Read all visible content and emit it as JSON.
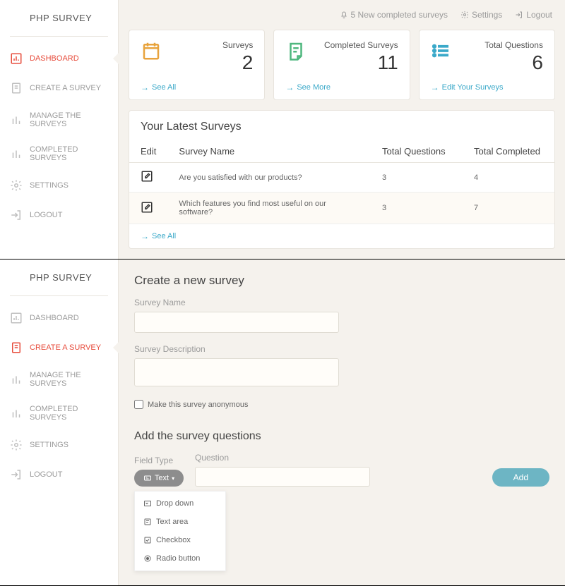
{
  "app_title": "PHP SURVEY",
  "topbar": {
    "notifications": "5 New completed surveys",
    "settings": "Settings",
    "logout": "Logout"
  },
  "nav": {
    "dashboard": "DASHBOARD",
    "create": "CREATE A SURVEY",
    "manage": "MANAGE THE SURVEYS",
    "completed": "COMPLETED SURVEYS",
    "settings": "SETTINGS",
    "logout": "LOGOUT"
  },
  "cards": {
    "surveys": {
      "label": "Surveys",
      "value": "2",
      "link": "See All"
    },
    "completed": {
      "label": "Completed Surveys",
      "value": "11",
      "link": "See More"
    },
    "questions": {
      "label": "Total Questions",
      "value": "6",
      "link": "Edit Your Surveys"
    }
  },
  "latest": {
    "title": "Your Latest Surveys",
    "headers": {
      "edit": "Edit",
      "name": "Survey Name",
      "questions": "Total Questions",
      "completed": "Total Completed"
    },
    "rows": [
      {
        "name": "Are you satisfied with our products?",
        "questions": "3",
        "completed": "4"
      },
      {
        "name": "Which features you find most useful on our software?",
        "questions": "3",
        "completed": "7"
      }
    ],
    "see_all": "See All"
  },
  "create": {
    "title": "Create a new survey",
    "name_label": "Survey Name",
    "desc_label": "Survey Description",
    "anon_label": "Make this survey anonymous",
    "questions_title": "Add the survey questions",
    "field_type_label": "Field Type",
    "question_label": "Question",
    "type_button": "Text",
    "add_button": "Add",
    "dropdown": {
      "dropdown": "Drop down",
      "textarea": "Text area",
      "checkbox": "Checkbox",
      "radio": "Radio button"
    }
  }
}
